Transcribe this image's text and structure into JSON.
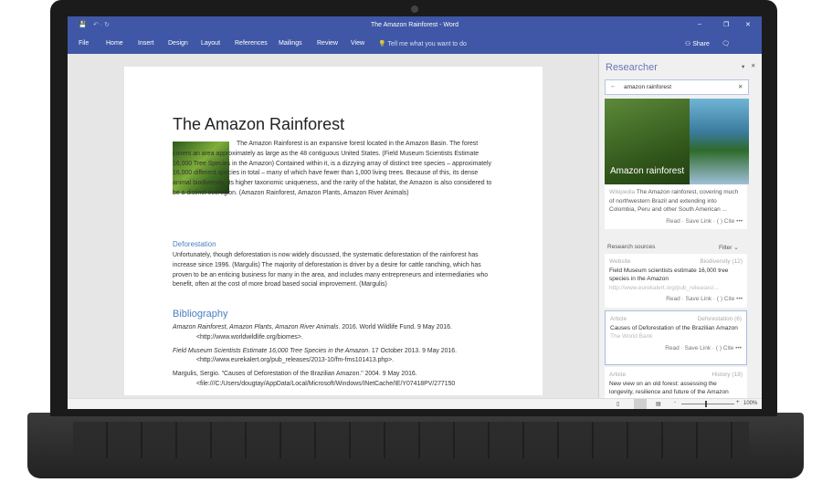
{
  "window": {
    "title": "The Amazon Rainforest - Word"
  },
  "ribbon": {
    "tabs": [
      "File",
      "Home",
      "Insert",
      "Design",
      "Layout",
      "References",
      "Mailings",
      "Review",
      "View"
    ],
    "tell_me": "Tell me what you want to do",
    "share": "Share"
  },
  "document": {
    "title": "The Amazon Rainforest",
    "intro": "The Amazon Rainforest is an expansive forest located in the Amazon Basin.  The forest covers an area approximately as large as the 48 contiguous United States. (Field Museum Scientists Estimate 16,000 Tree Species in the Amazon)  Contained within it, is a dizzying array of distinct tree species – approximately 16,000 different species in total – many of which have fewer than 1,000 living trees.  Because of this, its dense animal biodiversity, its higher taxonomic uniqueness, and the rarity of the habitat, the Amazon is also considered to be a distinct ecoregion. (Amazon Rainforest, Amazon Plants, Amazon River Animals)",
    "section_heading": "Deforestation",
    "section_body": "Unfortunately, though deforestation is now widely discussed, the systematic deforestation of the rainforest has increase since 1996. (Margulis) The majority of deforestation is driver by a desire for cattle ranching, which has proven to be an enticing business for many in the area, and includes many entrepreneurs and intermediaries who benefit, often at the cost of more broad based social improvement. (Margulis)",
    "bibliography_heading": "Bibliography",
    "bibliography": [
      {
        "italic": "Amazon Rainforest, Amazon Plants, Amazon River Animals",
        "rest": ". 2016. World Wildlife Fund. 9 May 2016.",
        "url": "<http://www.worldwildlife.org/biomes>."
      },
      {
        "italic": "Field Museum Scientists Estimate 16,000 Tree Species in the Amazon",
        "rest": ". 17 October 2013. 9 May 2016.",
        "url": "<http://www.eurekalert.org/pub_releases/2013-10/fm-fms101413.php>."
      },
      {
        "italic": "",
        "rest": "Margulis, Sergio. \"Causes of Deforestation of the Brazilian Amazon.\" 2004. 9 May 2016.",
        "url": "<file:///C:/Users/dougtay/AppData/Local/Microsoft/Windows/INetCache/IE/Y07418PV/277150"
      }
    ]
  },
  "researcher": {
    "title": "Researcher",
    "search_value": "amazon rainforest",
    "hero_caption": "Amazon rainforest",
    "wiki_source": "Wikipedia",
    "wiki_text": "The Amazon rainforest, covering much of northwestern Brazil and extending into Colombia, Peru and other South American ...",
    "actions": {
      "read": "Read",
      "save": "Save Link",
      "cite": "( ) Cite",
      "more": "•••"
    },
    "sources_label": "Research sources",
    "filter": "Filter",
    "sources": [
      {
        "type": "Website",
        "tag": "Biodiversity (12)",
        "title": "Field Museum scientists estimate 16,000 tree species in the Amazon",
        "sub": "http://www.eurekalert.org/pub_releases/..."
      },
      {
        "type": "Article",
        "tag": "Deforestation (6)",
        "title": "Causes of Deforestation of the Brazilian Amazon",
        "sub": "The World Bank"
      },
      {
        "type": "Article",
        "tag": "History (18)",
        "title": "New view on an old forest: assessing the longevity, resilience and future of the Amazon",
        "sub": ""
      }
    ]
  },
  "status": {
    "zoom": "100%"
  },
  "colors": {
    "accent": "#3f57a6",
    "heading": "#4a7fc1"
  }
}
